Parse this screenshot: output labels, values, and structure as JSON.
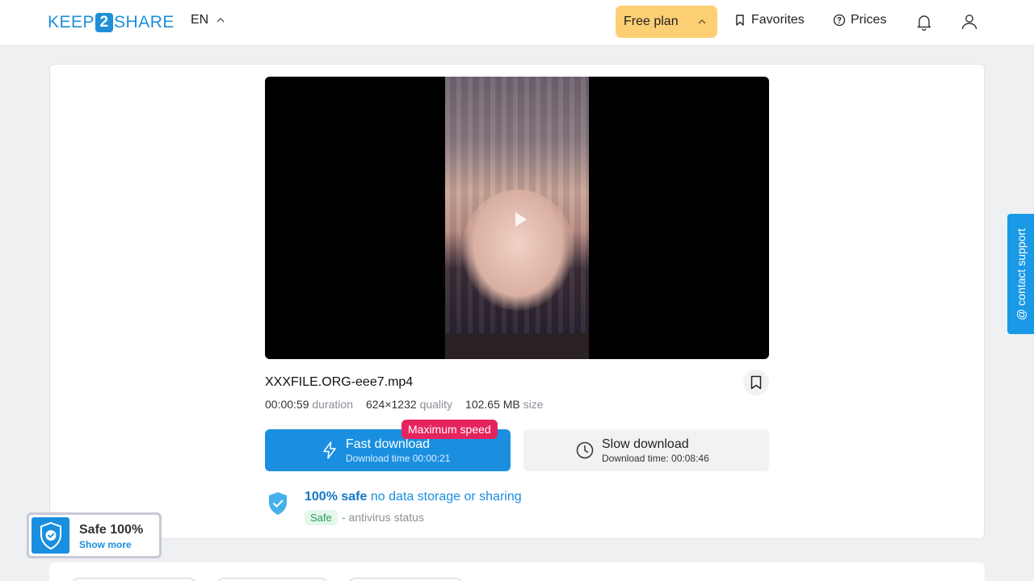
{
  "header": {
    "logo": {
      "part1": "KEEP",
      "part2": "2",
      "part3": "SHARE"
    },
    "language": "EN",
    "plan": "Free plan",
    "favorites": "Favorites",
    "prices": "Prices"
  },
  "file": {
    "name": "XXXFILE.ORG-eee7.mp4",
    "duration_value": "00:00:59",
    "duration_label": "duration",
    "quality_value": "624×1232",
    "quality_label": "quality",
    "size_value": "102.65 MB",
    "size_label": "size"
  },
  "download": {
    "badge": "Maximum speed",
    "fast_title": "Fast download",
    "fast_sub": "Download time 00:00:21",
    "slow_title": "Slow download",
    "slow_sub": "Download time: 00:08:46"
  },
  "safety": {
    "strong": "100% safe",
    "text": "no data storage or sharing",
    "badge": "Safe",
    "antivirus": "- antivirus status"
  },
  "support": {
    "label": "@ contact support"
  },
  "safe_widget": {
    "title": "Safe 100%",
    "more": "Show more"
  },
  "colors": {
    "accent": "#1a8fe0",
    "plan": "#fccf74",
    "badge": "#e5245e"
  }
}
